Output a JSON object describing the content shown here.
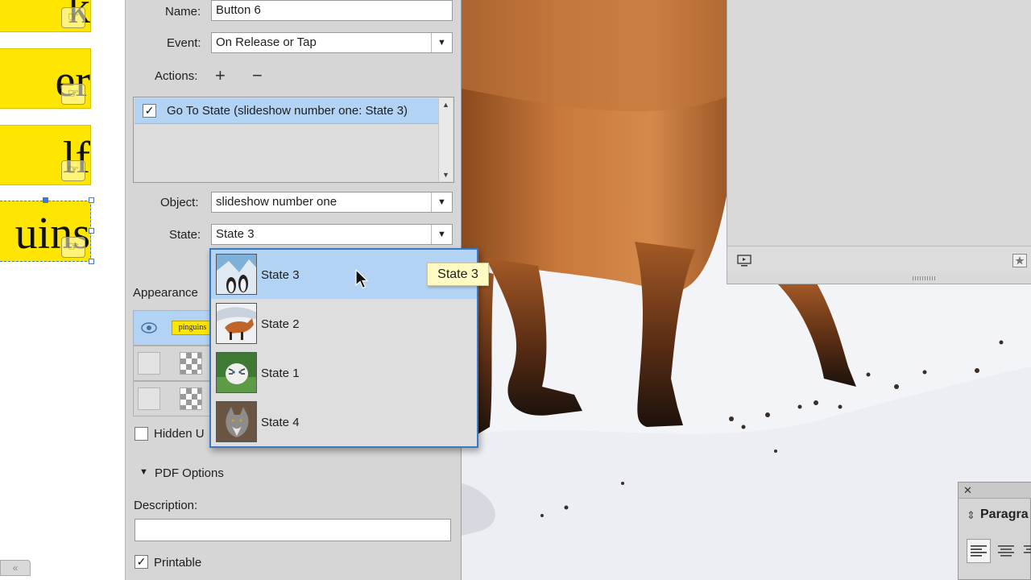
{
  "doc": {
    "button_words": [
      "k",
      "er",
      "lf",
      "uins"
    ],
    "hand_glyph": "☞"
  },
  "panel": {
    "name_label": "Name:",
    "name_value": "Button 6",
    "event_label": "Event:",
    "event_value": "On Release or Tap",
    "actions_label": "Actions:",
    "add_glyph": "+",
    "remove_glyph": "−",
    "action_item": "Go To State (slideshow number one: State 3)",
    "object_label": "Object:",
    "object_value": "slideshow number one",
    "state_label": "State:",
    "state_value": "State 3",
    "appearance_label": "Appearance",
    "appearance_thumb_text": "pinguins",
    "hidden_label": "Hidden U",
    "pdf_options_label": "PDF Options",
    "description_label": "Description:",
    "printable_label": "Printable",
    "check_glyph": "✓",
    "arrow_glyph": "▼",
    "triangle_glyph": "▼"
  },
  "popup": {
    "options": [
      {
        "label": "State 3",
        "thumb": "penguins",
        "selected": true
      },
      {
        "label": "State 2",
        "thumb": "red-fox"
      },
      {
        "label": "State 1",
        "thumb": "white-tiger"
      },
      {
        "label": "State 4",
        "thumb": "wolf"
      }
    ]
  },
  "tooltip": {
    "text": "State 3"
  },
  "right": {
    "paragraph_title": "Paragra",
    "close_glyph": "✕",
    "collapse_glyph": "«"
  },
  "colors": {
    "highlight": "#b3d3f5",
    "button_yellow": "#ffe600",
    "selection_blue": "#3d7ad6",
    "panel_gray": "#d6d6d6",
    "fox_orange": "#b8642a"
  }
}
